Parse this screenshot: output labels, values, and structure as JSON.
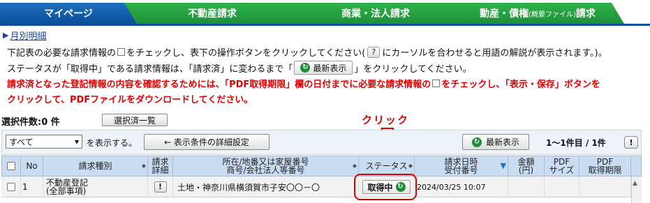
{
  "tabs": [
    {
      "label": "マイページ"
    },
    {
      "label": "不動産請求"
    },
    {
      "label": "商業・法人請求"
    },
    {
      "label": "動産・債権",
      "small": "(概要ファイル)",
      "suffix": "請求"
    }
  ],
  "breadcrumb": {
    "label": "月別明細"
  },
  "instructions": {
    "line1_a": "下記表の必要な請求情報の",
    "line1_b": "をチェックし、表下の操作ボタンをクリックしてください(",
    "line1_c": "にカーソルを合わせると用語の解説が表示されます。)。",
    "line2_a": "ステータスが「取得中」である請求情報は、「請求済」に変わるまで「",
    "line2_b": "」をクリックしてください。",
    "line3_a": "請求済となった登記情報の内容を確認するためには、「PDF取得期限」欄の日付までに必要な請求情報の",
    "line3_b": "をチェックし、「表示・保存」ボタンを",
    "line4": "クリックして、PDFファイルをダウンロードしてください。"
  },
  "selection": {
    "count_label": "選択件数:0 件",
    "list_button": "選択済一覧"
  },
  "annotation": {
    "label": "クリック"
  },
  "toolbar": {
    "filter_value": "すべて",
    "filter_suffix": "を表示する。",
    "conditions_button": "← 表示条件の詳細設定",
    "refresh_button": "最新表示",
    "page_info": "1〜1件目 / 1件"
  },
  "table": {
    "headers": {
      "no": "No",
      "type": "請求種別",
      "detail": "請求\n詳細",
      "location": "所在/地番又は家屋番号\n商号/会社法人等番号",
      "status": "ステータス",
      "datetime": "請求日時\n受付番号",
      "amount": "金額\n(円)",
      "pdf_size": "PDF\nサイズ",
      "pdf_deadline": "PDF\n取得期限"
    },
    "rows": [
      {
        "no": "1",
        "type": "不動産登記\n(全部事項)",
        "location": "土地・神奈川県横須賀市子安〇〇－〇",
        "status": "取得中",
        "datetime": "2024/03/25 10:07"
      }
    ]
  },
  "colors": {
    "tab_active": "#0b4f9a",
    "tab_inactive": "#1e8f38",
    "warning": "#e00000",
    "header_bg": "#c9dcf2"
  }
}
